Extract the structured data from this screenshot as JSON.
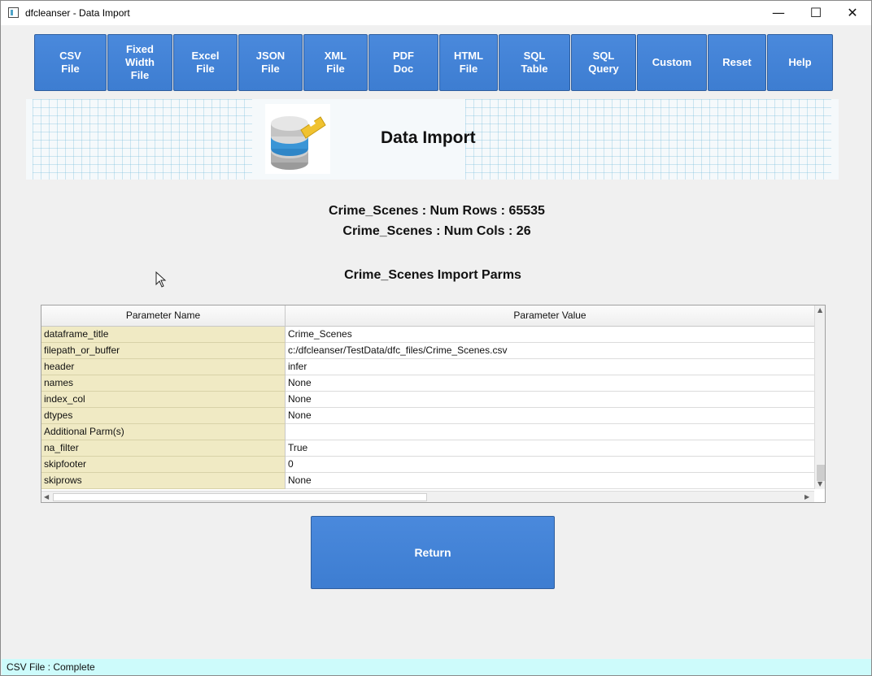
{
  "window": {
    "title": "dfcleanser - Data Import",
    "minimize_glyph": "—",
    "maximize_glyph": "☐",
    "close_glyph": "✕"
  },
  "toolbar": {
    "buttons": [
      {
        "label": "CSV\nFile"
      },
      {
        "label": "Fixed\nWidth\nFile"
      },
      {
        "label": "Excel\nFile"
      },
      {
        "label": "JSON\nFile"
      },
      {
        "label": "XML\nFile"
      },
      {
        "label": "PDF\nDoc"
      },
      {
        "label": "HTML\nFile"
      },
      {
        "label": "SQL\nTable"
      },
      {
        "label": "SQL\nQuery"
      },
      {
        "label": "Custom"
      },
      {
        "label": "Reset"
      },
      {
        "label": "Help"
      }
    ]
  },
  "banner": {
    "title": "Data Import",
    "icon": "database-icon"
  },
  "info": {
    "rows_text": "Crime_Scenes : Num Rows : 65535",
    "cols_text": "Crime_Scenes : Num Cols : 26"
  },
  "parms": {
    "title": "Crime_Scenes Import Parms",
    "columns": [
      "Parameter Name",
      "Parameter Value"
    ],
    "rows": [
      {
        "name": "dataframe_title",
        "value": "Crime_Scenes"
      },
      {
        "name": "filepath_or_buffer",
        "value": "c:/dfcleanser/TestData/dfc_files/Crime_Scenes.csv"
      },
      {
        "name": "header",
        "value": "infer"
      },
      {
        "name": "names",
        "value": "None"
      },
      {
        "name": "index_col",
        "value": "None"
      },
      {
        "name": "dtypes",
        "value": "None"
      },
      {
        "name": "Additional Parm(s)",
        "value": ""
      },
      {
        "name": "na_filter",
        "value": "True"
      },
      {
        "name": "skipfooter",
        "value": "0"
      },
      {
        "name": "skiprows",
        "value": "None"
      }
    ]
  },
  "return_label": "Return",
  "status": {
    "text": "CSV File : Complete"
  },
  "colors": {
    "button": "#3d7dd1",
    "name_cell": "#f0eac4",
    "status_bar": "#cdfbfb"
  }
}
